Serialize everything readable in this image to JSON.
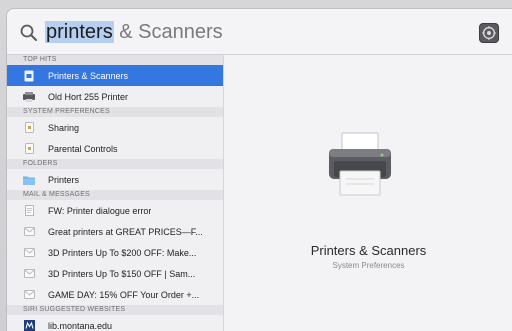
{
  "search": {
    "typed": "printers",
    "completion": " & Scanners"
  },
  "sections": {
    "top_hits": "TOP HITS",
    "system_preferences": "SYSTEM PREFERENCES",
    "folders": "FOLDERS",
    "mail": "MAIL & MESSAGES",
    "siri": "SIRI SUGGESTED WEBSITES"
  },
  "results": {
    "top_hits": [
      {
        "label": "Printers & Scanners",
        "icon": "printer-prefs-icon",
        "selected": true
      },
      {
        "label": "Old Hort 255 Printer",
        "icon": "printer-device-icon"
      }
    ],
    "system_preferences": [
      {
        "label": "Sharing",
        "icon": "sharing-prefs-icon"
      },
      {
        "label": "Parental Controls",
        "icon": "parental-controls-icon"
      }
    ],
    "folders": [
      {
        "label": "Printers",
        "icon": "folder-icon"
      }
    ],
    "mail": [
      {
        "label": "FW: Printer dialogue error",
        "icon": "mail-document-icon"
      },
      {
        "label": "Great printers at GREAT PRICES—F...",
        "icon": "mail-envelope-icon"
      },
      {
        "label": "3D Printers Up To $200 OFF: Make...",
        "icon": "mail-envelope-icon"
      },
      {
        "label": "3D Printers Up To $150 OFF | Sam...",
        "icon": "mail-envelope-icon"
      },
      {
        "label": "GAME DAY: 15% OFF Your Order +...",
        "icon": "mail-envelope-icon"
      }
    ],
    "siri": [
      {
        "label": "lib.montana.edu",
        "icon": "montana-site-icon"
      }
    ]
  },
  "preview": {
    "title": "Printers & Scanners",
    "subtitle": "System Preferences",
    "icon": "printer-icon"
  },
  "colors": {
    "selection": "#3477e0",
    "query_highlight": "#b6cff1"
  }
}
